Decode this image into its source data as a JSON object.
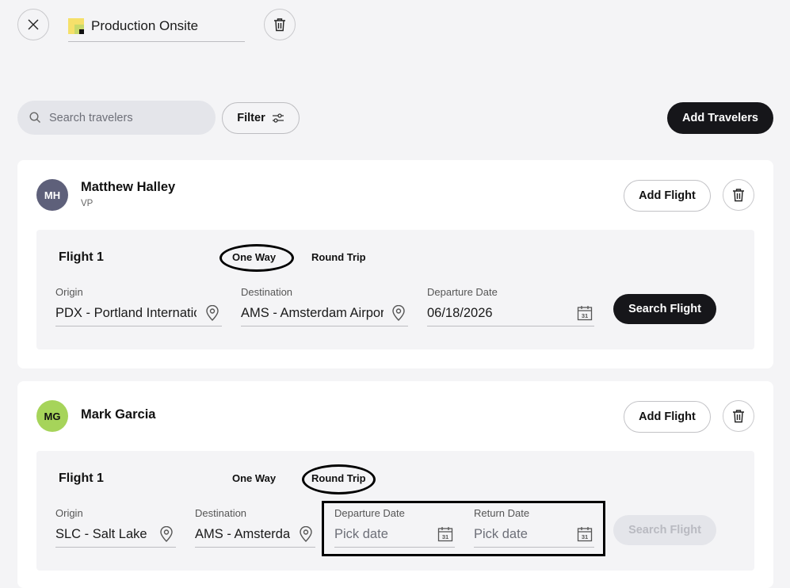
{
  "header": {
    "title": "Production Onsite"
  },
  "toolbar": {
    "search_placeholder": "Search travelers",
    "filter_label": "Filter",
    "add_travelers_label": "Add Travelers"
  },
  "travelers": [
    {
      "initials": "MH",
      "name": "Matthew Halley",
      "role": "VP",
      "avatar_color": "#5e607a",
      "add_flight_label": "Add Flight",
      "flight": {
        "title": "Flight 1",
        "one_way": "One Way",
        "round_trip": "Round Trip",
        "selected": "One Way",
        "origin_label": "Origin",
        "origin_value": "PDX - Portland International",
        "destination_label": "Destination",
        "destination_value": "AMS - Amsterdam Airport",
        "departure_label": "Departure Date",
        "departure_value": "06/18/2026",
        "search_label": "Search Flight"
      }
    },
    {
      "initials": "MG",
      "name": "Mark Garcia",
      "role": "",
      "avatar_color": "#a6d45a",
      "add_flight_label": "Add Flight",
      "flight": {
        "title": "Flight 1",
        "one_way": "One Way",
        "round_trip": "Round Trip",
        "selected": "Round Trip",
        "origin_label": "Origin",
        "origin_value": "SLC - Salt Lake City",
        "destination_label": "Destination",
        "destination_value": "AMS - Amsterdam",
        "departure_label": "Departure Date",
        "departure_placeholder": "Pick date",
        "return_label": "Return Date",
        "return_placeholder": "Pick date",
        "search_label": "Search Flight"
      }
    }
  ],
  "icons": {
    "close": "close-icon",
    "trash": "trash-icon",
    "search": "search-icon",
    "filter": "sliders-icon",
    "pin": "map-pin-icon",
    "calendar": "calendar-icon",
    "calendar_day": "31"
  },
  "colors": {
    "dark_button": "#16161a",
    "page_bg": "#f4f4f6",
    "note_yellow": "#f5e06a"
  }
}
